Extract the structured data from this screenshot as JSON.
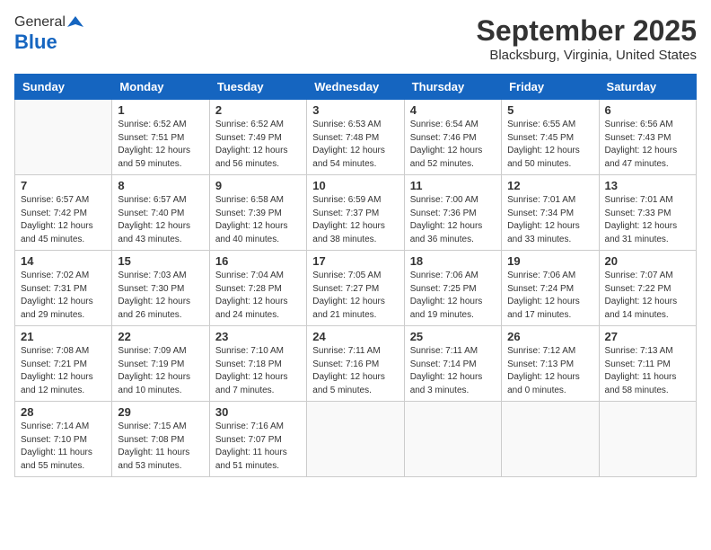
{
  "header": {
    "logo_general": "General",
    "logo_blue": "Blue",
    "month_title": "September 2025",
    "location": "Blacksburg, Virginia, United States"
  },
  "weekdays": [
    "Sunday",
    "Monday",
    "Tuesday",
    "Wednesday",
    "Thursday",
    "Friday",
    "Saturday"
  ],
  "weeks": [
    [
      {
        "day": "",
        "info": ""
      },
      {
        "day": "1",
        "info": "Sunrise: 6:52 AM\nSunset: 7:51 PM\nDaylight: 12 hours\nand 59 minutes."
      },
      {
        "day": "2",
        "info": "Sunrise: 6:52 AM\nSunset: 7:49 PM\nDaylight: 12 hours\nand 56 minutes."
      },
      {
        "day": "3",
        "info": "Sunrise: 6:53 AM\nSunset: 7:48 PM\nDaylight: 12 hours\nand 54 minutes."
      },
      {
        "day": "4",
        "info": "Sunrise: 6:54 AM\nSunset: 7:46 PM\nDaylight: 12 hours\nand 52 minutes."
      },
      {
        "day": "5",
        "info": "Sunrise: 6:55 AM\nSunset: 7:45 PM\nDaylight: 12 hours\nand 50 minutes."
      },
      {
        "day": "6",
        "info": "Sunrise: 6:56 AM\nSunset: 7:43 PM\nDaylight: 12 hours\nand 47 minutes."
      }
    ],
    [
      {
        "day": "7",
        "info": "Sunrise: 6:57 AM\nSunset: 7:42 PM\nDaylight: 12 hours\nand 45 minutes."
      },
      {
        "day": "8",
        "info": "Sunrise: 6:57 AM\nSunset: 7:40 PM\nDaylight: 12 hours\nand 43 minutes."
      },
      {
        "day": "9",
        "info": "Sunrise: 6:58 AM\nSunset: 7:39 PM\nDaylight: 12 hours\nand 40 minutes."
      },
      {
        "day": "10",
        "info": "Sunrise: 6:59 AM\nSunset: 7:37 PM\nDaylight: 12 hours\nand 38 minutes."
      },
      {
        "day": "11",
        "info": "Sunrise: 7:00 AM\nSunset: 7:36 PM\nDaylight: 12 hours\nand 36 minutes."
      },
      {
        "day": "12",
        "info": "Sunrise: 7:01 AM\nSunset: 7:34 PM\nDaylight: 12 hours\nand 33 minutes."
      },
      {
        "day": "13",
        "info": "Sunrise: 7:01 AM\nSunset: 7:33 PM\nDaylight: 12 hours\nand 31 minutes."
      }
    ],
    [
      {
        "day": "14",
        "info": "Sunrise: 7:02 AM\nSunset: 7:31 PM\nDaylight: 12 hours\nand 29 minutes."
      },
      {
        "day": "15",
        "info": "Sunrise: 7:03 AM\nSunset: 7:30 PM\nDaylight: 12 hours\nand 26 minutes."
      },
      {
        "day": "16",
        "info": "Sunrise: 7:04 AM\nSunset: 7:28 PM\nDaylight: 12 hours\nand 24 minutes."
      },
      {
        "day": "17",
        "info": "Sunrise: 7:05 AM\nSunset: 7:27 PM\nDaylight: 12 hours\nand 21 minutes."
      },
      {
        "day": "18",
        "info": "Sunrise: 7:06 AM\nSunset: 7:25 PM\nDaylight: 12 hours\nand 19 minutes."
      },
      {
        "day": "19",
        "info": "Sunrise: 7:06 AM\nSunset: 7:24 PM\nDaylight: 12 hours\nand 17 minutes."
      },
      {
        "day": "20",
        "info": "Sunrise: 7:07 AM\nSunset: 7:22 PM\nDaylight: 12 hours\nand 14 minutes."
      }
    ],
    [
      {
        "day": "21",
        "info": "Sunrise: 7:08 AM\nSunset: 7:21 PM\nDaylight: 12 hours\nand 12 minutes."
      },
      {
        "day": "22",
        "info": "Sunrise: 7:09 AM\nSunset: 7:19 PM\nDaylight: 12 hours\nand 10 minutes."
      },
      {
        "day": "23",
        "info": "Sunrise: 7:10 AM\nSunset: 7:18 PM\nDaylight: 12 hours\nand 7 minutes."
      },
      {
        "day": "24",
        "info": "Sunrise: 7:11 AM\nSunset: 7:16 PM\nDaylight: 12 hours\nand 5 minutes."
      },
      {
        "day": "25",
        "info": "Sunrise: 7:11 AM\nSunset: 7:14 PM\nDaylight: 12 hours\nand 3 minutes."
      },
      {
        "day": "26",
        "info": "Sunrise: 7:12 AM\nSunset: 7:13 PM\nDaylight: 12 hours\nand 0 minutes."
      },
      {
        "day": "27",
        "info": "Sunrise: 7:13 AM\nSunset: 7:11 PM\nDaylight: 11 hours\nand 58 minutes."
      }
    ],
    [
      {
        "day": "28",
        "info": "Sunrise: 7:14 AM\nSunset: 7:10 PM\nDaylight: 11 hours\nand 55 minutes."
      },
      {
        "day": "29",
        "info": "Sunrise: 7:15 AM\nSunset: 7:08 PM\nDaylight: 11 hours\nand 53 minutes."
      },
      {
        "day": "30",
        "info": "Sunrise: 7:16 AM\nSunset: 7:07 PM\nDaylight: 11 hours\nand 51 minutes."
      },
      {
        "day": "",
        "info": ""
      },
      {
        "day": "",
        "info": ""
      },
      {
        "day": "",
        "info": ""
      },
      {
        "day": "",
        "info": ""
      }
    ]
  ]
}
